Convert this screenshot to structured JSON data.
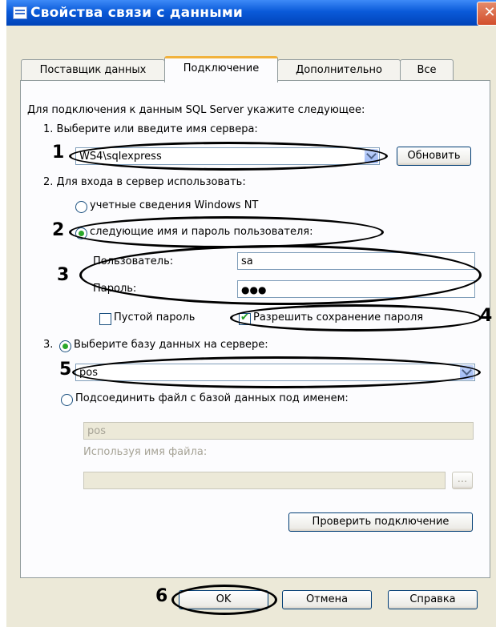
{
  "window": {
    "title": "Свойства связи с данными",
    "close": "✕"
  },
  "tabs": [
    "Поставщик данных",
    "Подключение",
    "Дополнительно",
    "Все"
  ],
  "content": {
    "intro": "Для подключения к данным SQL Server укажите следующее:",
    "step1": "1. Выберите или введите имя сервера:",
    "server_value": "WS4\\sqlexpress",
    "refresh": "Обновить",
    "step2": "2. Для входа в сервер использовать:",
    "radio_nt": "учетные сведения Windows NT",
    "radio_user": "следующие имя и пароль пользователя:",
    "user_label": "Пользователь:",
    "user_value": "sa",
    "pass_label": "Пароль:",
    "pass_value": "●●●",
    "blank_pass": "Пустой пароль",
    "allow_save": "Разрешить сохранение пароля",
    "step3_prefix": "3.",
    "radio_db": "Выберите базу данных на сервере:",
    "db_value": "pos",
    "radio_attach": "Подсоединить файл с базой данных под именем:",
    "attach_value": "pos",
    "using_file": "Используя имя файла:",
    "browse": "...",
    "test": "Проверить подключение"
  },
  "footer": {
    "ok": "OK",
    "cancel": "Отмена",
    "help": "Справка"
  },
  "annotations": [
    "1",
    "2",
    "3",
    "4",
    "5",
    "6"
  ]
}
